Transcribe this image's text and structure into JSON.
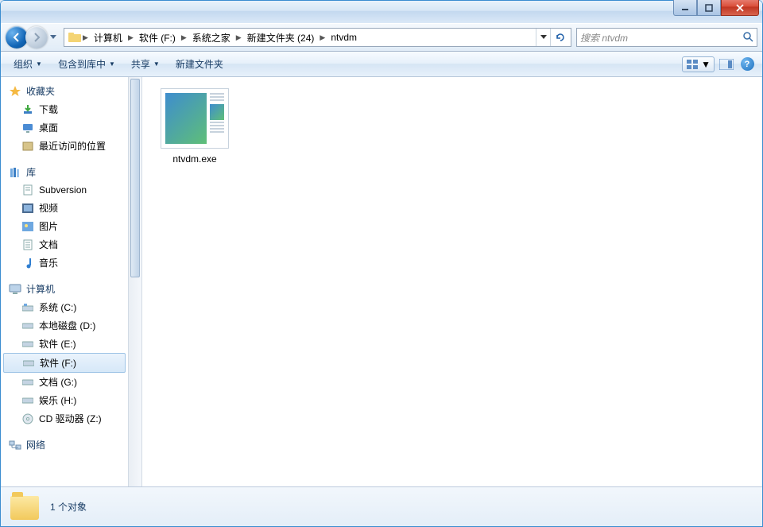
{
  "breadcrumbs": [
    "计算机",
    "软件 (F:)",
    "系统之家",
    "新建文件夹 (24)",
    "ntvdm"
  ],
  "search": {
    "placeholder": "搜索 ntvdm"
  },
  "toolbar": {
    "organize": "组织",
    "include": "包含到库中",
    "share": "共享",
    "newfolder": "新建文件夹"
  },
  "sidebar": {
    "favorites": {
      "label": "收藏夹",
      "items": [
        "下载",
        "桌面",
        "最近访问的位置"
      ]
    },
    "libraries": {
      "label": "库",
      "items": [
        "Subversion",
        "视频",
        "图片",
        "文档",
        "音乐"
      ]
    },
    "computer": {
      "label": "计算机",
      "items": [
        "系统 (C:)",
        "本地磁盘 (D:)",
        "软件 (E:)",
        "软件 (F:)",
        "文档 (G:)",
        "娱乐 (H:)",
        "CD 驱动器 (Z:)"
      ],
      "selected_index": 3
    },
    "network": {
      "label": "网络"
    }
  },
  "files": [
    {
      "name": "ntvdm.exe"
    }
  ],
  "details": {
    "count_label": "1 个对象"
  }
}
